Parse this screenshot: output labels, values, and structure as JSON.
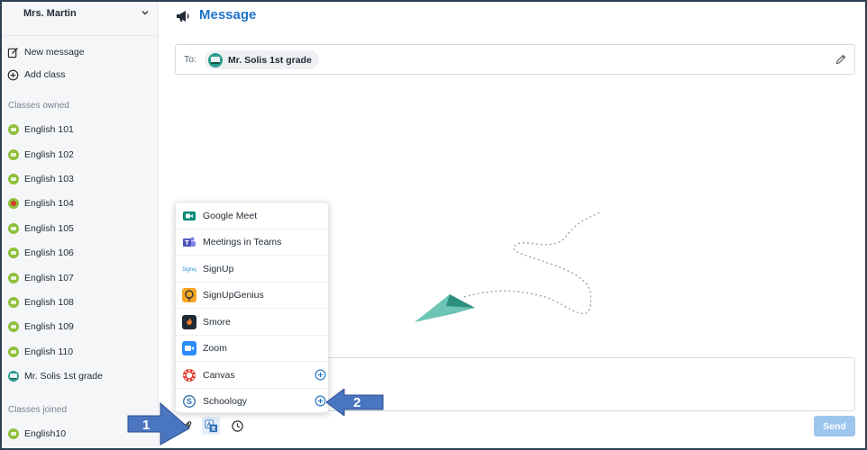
{
  "sidebar": {
    "user_name": "Mrs. Martin",
    "actions": [
      {
        "label": "New message",
        "icon": "compose-icon"
      },
      {
        "label": "Add class",
        "icon": "plus-circle-icon"
      }
    ],
    "classes_owned_header": "Classes owned",
    "classes_owned": [
      {
        "label": "English 101",
        "avatar": "green"
      },
      {
        "label": "English 102",
        "avatar": "green"
      },
      {
        "label": "English 103",
        "avatar": "green"
      },
      {
        "label": "English 104",
        "avatar": "red"
      },
      {
        "label": "English 105",
        "avatar": "green"
      },
      {
        "label": "English 106",
        "avatar": "green"
      },
      {
        "label": "English 107",
        "avatar": "green"
      },
      {
        "label": "English 108",
        "avatar": "green"
      },
      {
        "label": "English 109",
        "avatar": "green"
      },
      {
        "label": "English 110",
        "avatar": "green"
      },
      {
        "label": "Mr. Solis 1st grade",
        "avatar": "teal"
      }
    ],
    "classes_joined_header": "Classes joined",
    "classes_joined": [
      {
        "label": "English10",
        "avatar": "green"
      }
    ]
  },
  "main": {
    "title": "Message",
    "to_label": "To:",
    "recipient": "Mr. Solis 1st grade",
    "send_label": "Send"
  },
  "attach_menu": {
    "items": [
      {
        "label": "Google Meet",
        "icon": "google-meet-icon",
        "addable": false
      },
      {
        "label": "Meetings in Teams",
        "icon": "teams-icon",
        "addable": false
      },
      {
        "label": "SignUp",
        "icon": "signup-icon",
        "addable": false
      },
      {
        "label": "SignUpGenius",
        "icon": "signupgenius-icon",
        "addable": false
      },
      {
        "label": "Smore",
        "icon": "smore-icon",
        "addable": false
      },
      {
        "label": "Zoom",
        "icon": "zoom-icon",
        "addable": false
      },
      {
        "label": "Canvas",
        "icon": "canvas-icon",
        "addable": true
      },
      {
        "label": "Schoology",
        "icon": "schoology-icon",
        "addable": true
      }
    ]
  },
  "callouts": {
    "one": "1",
    "two": "2"
  },
  "colors": {
    "accent": "#1e74c9",
    "send_disabled": "#9dc6ef",
    "callout": "#4a76c0",
    "sidebar_bg": "#f5f6f8"
  }
}
